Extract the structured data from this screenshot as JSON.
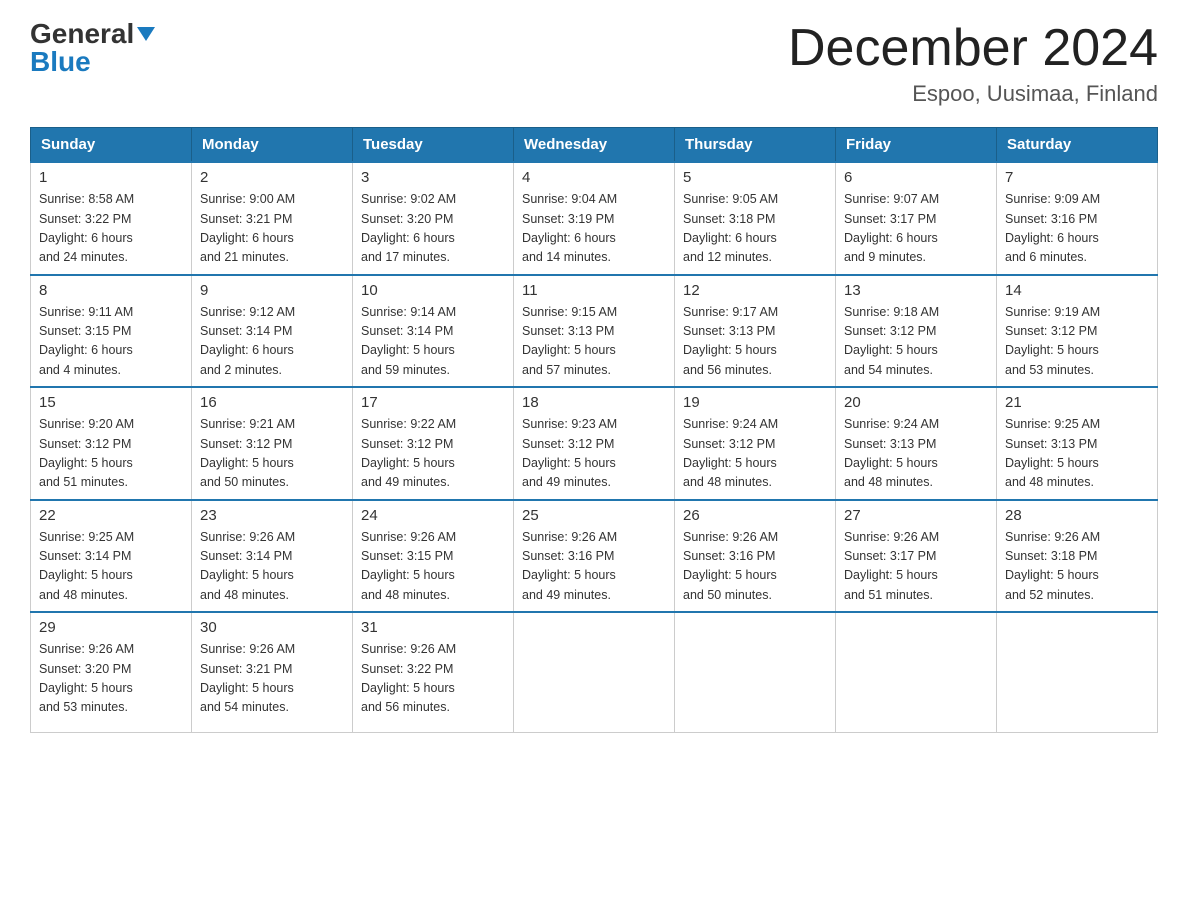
{
  "logo": {
    "general": "General",
    "blue": "Blue",
    "triangle": "▼"
  },
  "title": "December 2024",
  "subtitle": "Espoo, Uusimaa, Finland",
  "headers": [
    "Sunday",
    "Monday",
    "Tuesday",
    "Wednesday",
    "Thursday",
    "Friday",
    "Saturday"
  ],
  "weeks": [
    [
      {
        "day": "1",
        "info": "Sunrise: 8:58 AM\nSunset: 3:22 PM\nDaylight: 6 hours\nand 24 minutes."
      },
      {
        "day": "2",
        "info": "Sunrise: 9:00 AM\nSunset: 3:21 PM\nDaylight: 6 hours\nand 21 minutes."
      },
      {
        "day": "3",
        "info": "Sunrise: 9:02 AM\nSunset: 3:20 PM\nDaylight: 6 hours\nand 17 minutes."
      },
      {
        "day": "4",
        "info": "Sunrise: 9:04 AM\nSunset: 3:19 PM\nDaylight: 6 hours\nand 14 minutes."
      },
      {
        "day": "5",
        "info": "Sunrise: 9:05 AM\nSunset: 3:18 PM\nDaylight: 6 hours\nand 12 minutes."
      },
      {
        "day": "6",
        "info": "Sunrise: 9:07 AM\nSunset: 3:17 PM\nDaylight: 6 hours\nand 9 minutes."
      },
      {
        "day": "7",
        "info": "Sunrise: 9:09 AM\nSunset: 3:16 PM\nDaylight: 6 hours\nand 6 minutes."
      }
    ],
    [
      {
        "day": "8",
        "info": "Sunrise: 9:11 AM\nSunset: 3:15 PM\nDaylight: 6 hours\nand 4 minutes."
      },
      {
        "day": "9",
        "info": "Sunrise: 9:12 AM\nSunset: 3:14 PM\nDaylight: 6 hours\nand 2 minutes."
      },
      {
        "day": "10",
        "info": "Sunrise: 9:14 AM\nSunset: 3:14 PM\nDaylight: 5 hours\nand 59 minutes."
      },
      {
        "day": "11",
        "info": "Sunrise: 9:15 AM\nSunset: 3:13 PM\nDaylight: 5 hours\nand 57 minutes."
      },
      {
        "day": "12",
        "info": "Sunrise: 9:17 AM\nSunset: 3:13 PM\nDaylight: 5 hours\nand 56 minutes."
      },
      {
        "day": "13",
        "info": "Sunrise: 9:18 AM\nSunset: 3:12 PM\nDaylight: 5 hours\nand 54 minutes."
      },
      {
        "day": "14",
        "info": "Sunrise: 9:19 AM\nSunset: 3:12 PM\nDaylight: 5 hours\nand 53 minutes."
      }
    ],
    [
      {
        "day": "15",
        "info": "Sunrise: 9:20 AM\nSunset: 3:12 PM\nDaylight: 5 hours\nand 51 minutes."
      },
      {
        "day": "16",
        "info": "Sunrise: 9:21 AM\nSunset: 3:12 PM\nDaylight: 5 hours\nand 50 minutes."
      },
      {
        "day": "17",
        "info": "Sunrise: 9:22 AM\nSunset: 3:12 PM\nDaylight: 5 hours\nand 49 minutes."
      },
      {
        "day": "18",
        "info": "Sunrise: 9:23 AM\nSunset: 3:12 PM\nDaylight: 5 hours\nand 49 minutes."
      },
      {
        "day": "19",
        "info": "Sunrise: 9:24 AM\nSunset: 3:12 PM\nDaylight: 5 hours\nand 48 minutes."
      },
      {
        "day": "20",
        "info": "Sunrise: 9:24 AM\nSunset: 3:13 PM\nDaylight: 5 hours\nand 48 minutes."
      },
      {
        "day": "21",
        "info": "Sunrise: 9:25 AM\nSunset: 3:13 PM\nDaylight: 5 hours\nand 48 minutes."
      }
    ],
    [
      {
        "day": "22",
        "info": "Sunrise: 9:25 AM\nSunset: 3:14 PM\nDaylight: 5 hours\nand 48 minutes."
      },
      {
        "day": "23",
        "info": "Sunrise: 9:26 AM\nSunset: 3:14 PM\nDaylight: 5 hours\nand 48 minutes."
      },
      {
        "day": "24",
        "info": "Sunrise: 9:26 AM\nSunset: 3:15 PM\nDaylight: 5 hours\nand 48 minutes."
      },
      {
        "day": "25",
        "info": "Sunrise: 9:26 AM\nSunset: 3:16 PM\nDaylight: 5 hours\nand 49 minutes."
      },
      {
        "day": "26",
        "info": "Sunrise: 9:26 AM\nSunset: 3:16 PM\nDaylight: 5 hours\nand 50 minutes."
      },
      {
        "day": "27",
        "info": "Sunrise: 9:26 AM\nSunset: 3:17 PM\nDaylight: 5 hours\nand 51 minutes."
      },
      {
        "day": "28",
        "info": "Sunrise: 9:26 AM\nSunset: 3:18 PM\nDaylight: 5 hours\nand 52 minutes."
      }
    ],
    [
      {
        "day": "29",
        "info": "Sunrise: 9:26 AM\nSunset: 3:20 PM\nDaylight: 5 hours\nand 53 minutes."
      },
      {
        "day": "30",
        "info": "Sunrise: 9:26 AM\nSunset: 3:21 PM\nDaylight: 5 hours\nand 54 minutes."
      },
      {
        "day": "31",
        "info": "Sunrise: 9:26 AM\nSunset: 3:22 PM\nDaylight: 5 hours\nand 56 minutes."
      },
      {
        "day": "",
        "info": ""
      },
      {
        "day": "",
        "info": ""
      },
      {
        "day": "",
        "info": ""
      },
      {
        "day": "",
        "info": ""
      }
    ]
  ]
}
